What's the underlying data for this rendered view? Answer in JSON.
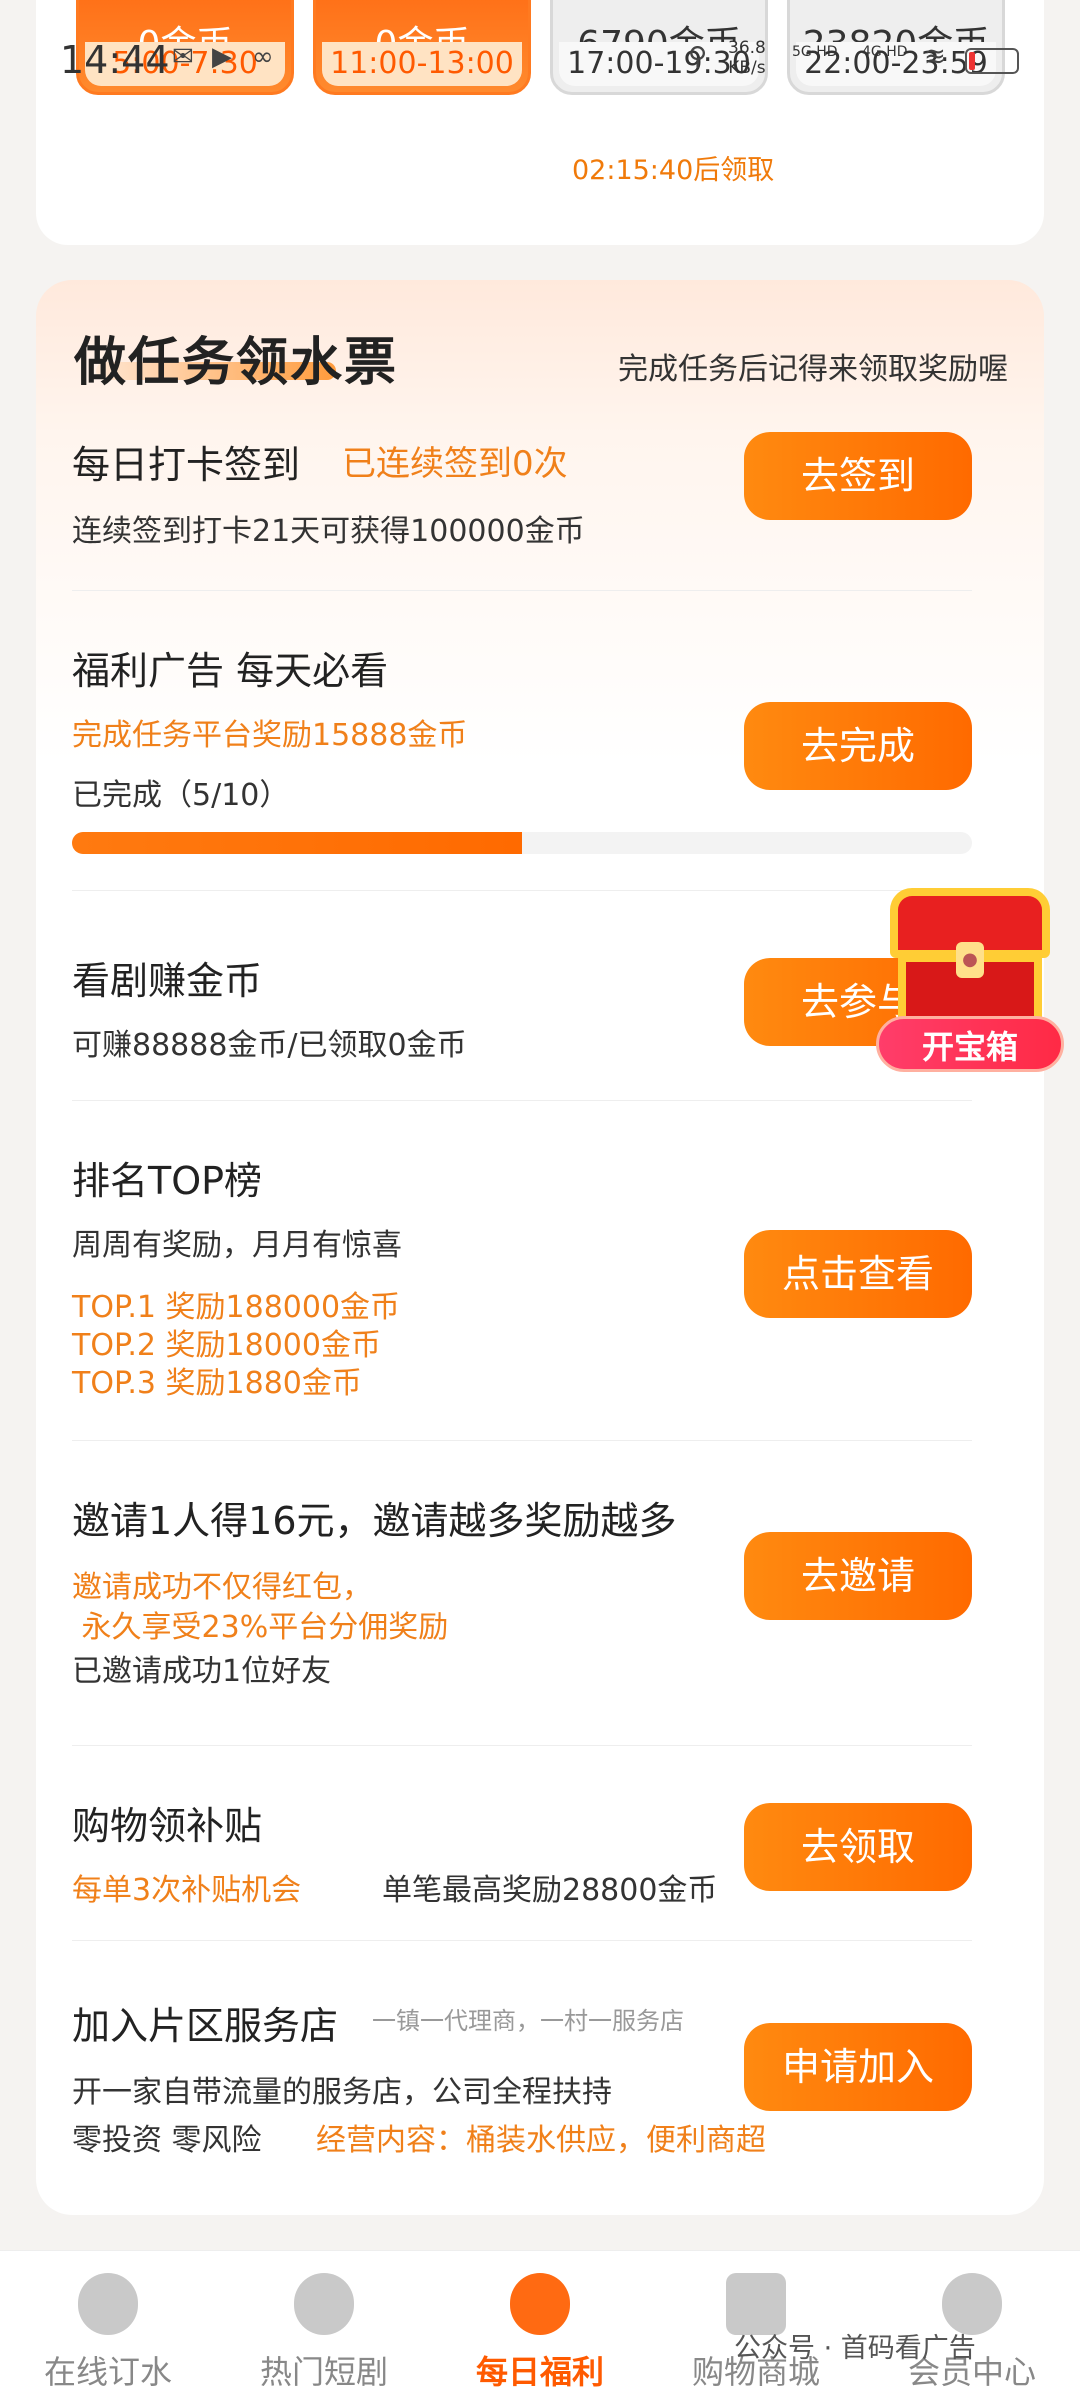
{
  "status_bar": {
    "time": "14:44",
    "net_speed": "36.8",
    "net_unit": "KB/s",
    "sig1": "5G HD",
    "sig2": "4G HD"
  },
  "slots": [
    {
      "coins": "0金币",
      "time": "5:00-7:30",
      "state": "active"
    },
    {
      "coins": "0金币",
      "time": "11:00-13:00",
      "state": "active"
    },
    {
      "coins": "6790金币",
      "time": "17:00-19:30",
      "state": "off"
    },
    {
      "coins": "23820金币",
      "time": "22:00-23:59",
      "state": "off"
    }
  ],
  "countdown": "02:15:40后领取",
  "panel": {
    "title": "做任务领水票",
    "subtitle": "完成任务后记得来领取奖励喔"
  },
  "tasks": {
    "checkin": {
      "name": "每日打卡签到",
      "status": "已连续签到0次",
      "desc": "连续签到打卡21天可获得100000金币",
      "button": "去签到"
    },
    "ad": {
      "name": "福利广告 每天必看",
      "reward": "完成任务平台奖励15888金币",
      "progress_text": "已完成（5/10）",
      "progress": 0.5,
      "button": "去完成"
    },
    "drama": {
      "name": "看剧赚金币",
      "desc": "可赚88888金币/已领取0金币",
      "button": "去参与"
    },
    "ranking": {
      "name": "排名TOP榜",
      "desc": "周周有奖励，月月有惊喜",
      "top1": "TOP.1 奖励188000金币",
      "top2": "TOP.2 奖励18000金币",
      "top3": "TOP.3 奖励1880金币",
      "button": "点击查看"
    },
    "invite": {
      "name": "邀请1人得16元，邀请越多奖励越多",
      "line1": "邀请成功不仅得红包，",
      "line2": " 永久享受23%平台分佣奖励",
      "line3": "已邀请成功1位好友",
      "button": "去邀请"
    },
    "shopping": {
      "name": "购物领补贴",
      "line_orange": "每单3次补贴机会",
      "line_dark": "单笔最高奖励28800金币",
      "button": "去领取"
    },
    "store": {
      "name": "加入片区服务店",
      "tagline": "一镇一代理商，一村一服务店",
      "line1": "开一家自带流量的服务店，公司全程扶持",
      "line2a": "零投资 零风险",
      "line2b": "经营内容：桶装水供应，便利商超",
      "button": "申请加入"
    }
  },
  "treasure": {
    "label": "开宝箱"
  },
  "nav": [
    {
      "label": "在线订水",
      "icon": "water-drop-icon"
    },
    {
      "label": "热门短剧",
      "icon": "film-reel-icon"
    },
    {
      "label": "每日福利",
      "icon": "gift-bag-icon",
      "active": true
    },
    {
      "label": "购物商城",
      "icon": "shopping-bag-icon"
    },
    {
      "label": "会员中心",
      "icon": "user-icon"
    }
  ],
  "watermark": "公众号 · 首码看广告",
  "colors": {
    "accent": "#ff6a00",
    "accent_text": "#f0801a"
  }
}
